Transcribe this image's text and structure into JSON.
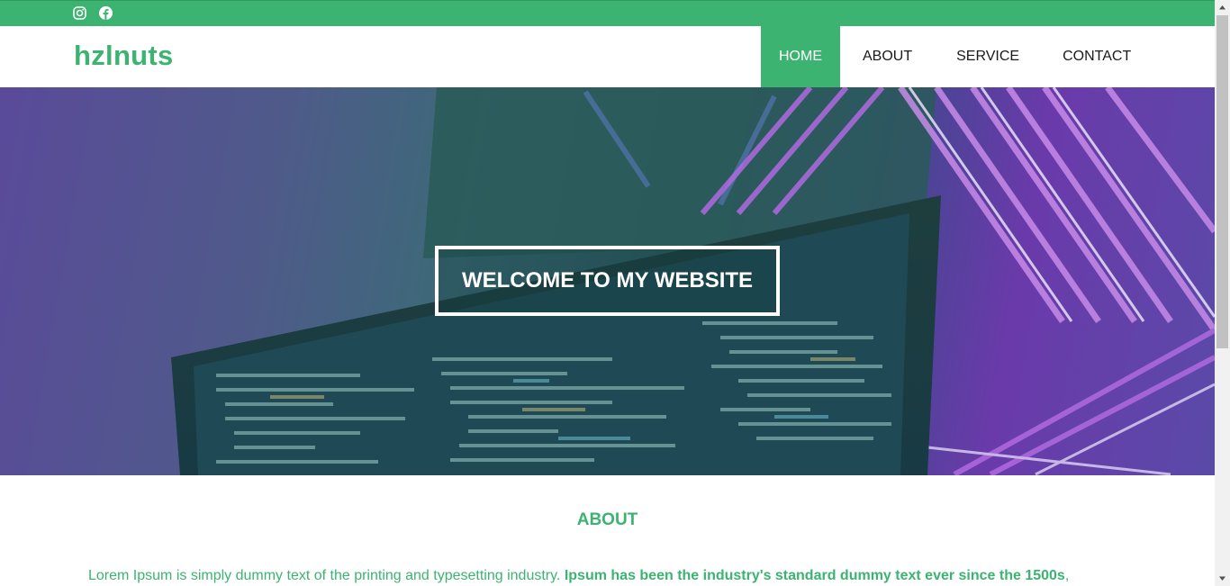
{
  "topbar": {
    "icons": [
      "instagram-icon",
      "facebook-icon"
    ],
    "color": "#3cb371"
  },
  "brand": {
    "logo": "hzlnuts"
  },
  "nav": {
    "items": [
      {
        "label": "HOME",
        "active": true
      },
      {
        "label": "ABOUT",
        "active": false
      },
      {
        "label": "SERVICE",
        "active": false
      },
      {
        "label": "CONTACT",
        "active": false
      }
    ]
  },
  "hero": {
    "heading": "WELCOME TO MY WEBSITE"
  },
  "about": {
    "title": "ABOUT",
    "text_plain": "Lorem Ipsum is simply dummy text of the printing and typesetting industry. ",
    "text_bold": "Ipsum has been the industry's standard dummy text ever since the 1500s",
    "text_tail": ","
  },
  "colors": {
    "accent": "#3cb371",
    "nav_text": "#1a1a1a"
  }
}
